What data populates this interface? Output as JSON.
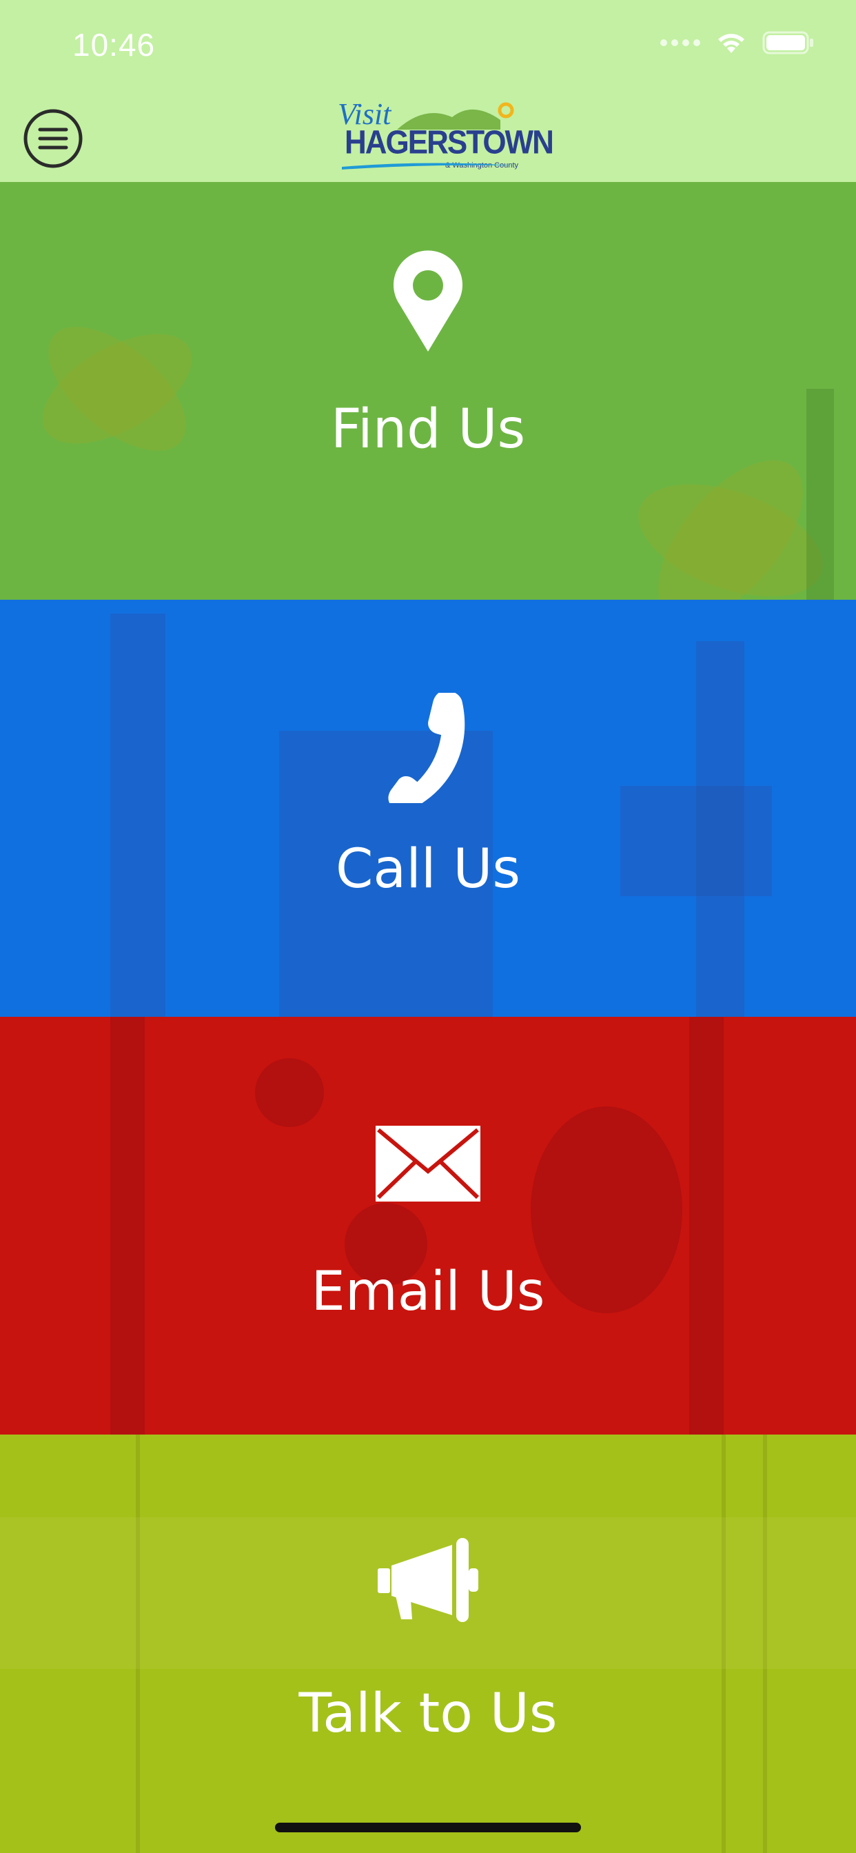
{
  "status_bar": {
    "time": "10:46"
  },
  "header": {
    "logo": {
      "visit": "Visit",
      "name": "HAGERSTOWN",
      "county": "& Washington County"
    },
    "menu_icon": "menu-icon"
  },
  "tiles": [
    {
      "label": "Find Us",
      "icon": "map-pin-icon",
      "color": "#6db543"
    },
    {
      "label": "Call Us",
      "icon": "phone-icon",
      "color": "#1170e0"
    },
    {
      "label": "Email Us",
      "icon": "envelope-icon",
      "color": "#c8140e"
    },
    {
      "label": "Talk to Us",
      "icon": "megaphone-icon",
      "color": "#a4c11a"
    }
  ],
  "colors": {
    "header_bg": "#c3f0a2",
    "text": "#ffffff"
  }
}
